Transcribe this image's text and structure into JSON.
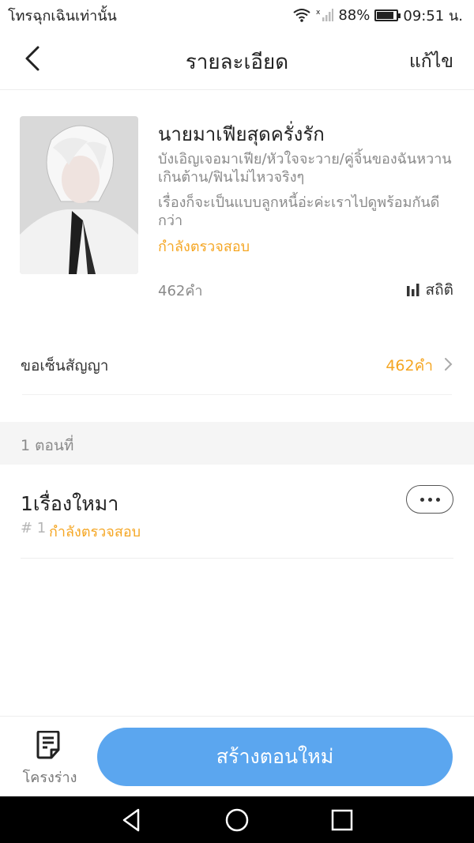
{
  "status_bar": {
    "carrier": "โทรฉุกเฉินเท่านั้น",
    "battery": "88%",
    "battery_level": 0.88,
    "time": "09:51 น."
  },
  "nav": {
    "title": "รายละเอียด",
    "edit_label": "แก้ไข"
  },
  "story": {
    "title": "นายมาเฟียสุดครั่งรัก",
    "tags": "บังเอิญเจอมาเฟีย/หัวใจจะวาย/คู่จิ้นของฉันหวานเกินต้าน/ฟินไม่ไหวจริงๆ",
    "description": "เรื่องก็จะเป็นแบบลูกหนี้อ่ะค่ะเราไปดูพร้อมกันดีกว่า",
    "status": "กำลังตรวจสอบ",
    "word_count": "462คำ",
    "stats_label": "สถิติ"
  },
  "contract": {
    "label": "ขอเซ็นสัญญา",
    "value": "462คำ"
  },
  "chapters_section": {
    "header": "1 ตอนที่",
    "items": [
      {
        "title": "1เรื่องใหมา",
        "number": "# 1",
        "status": "กำลังตรวจสอบ"
      }
    ]
  },
  "bottom_bar": {
    "outline_label": "โครงร่าง",
    "create_label": "สร้างตอนใหม่"
  },
  "colors": {
    "accent_orange": "#f5a623",
    "primary_blue": "#5ba6ef"
  }
}
